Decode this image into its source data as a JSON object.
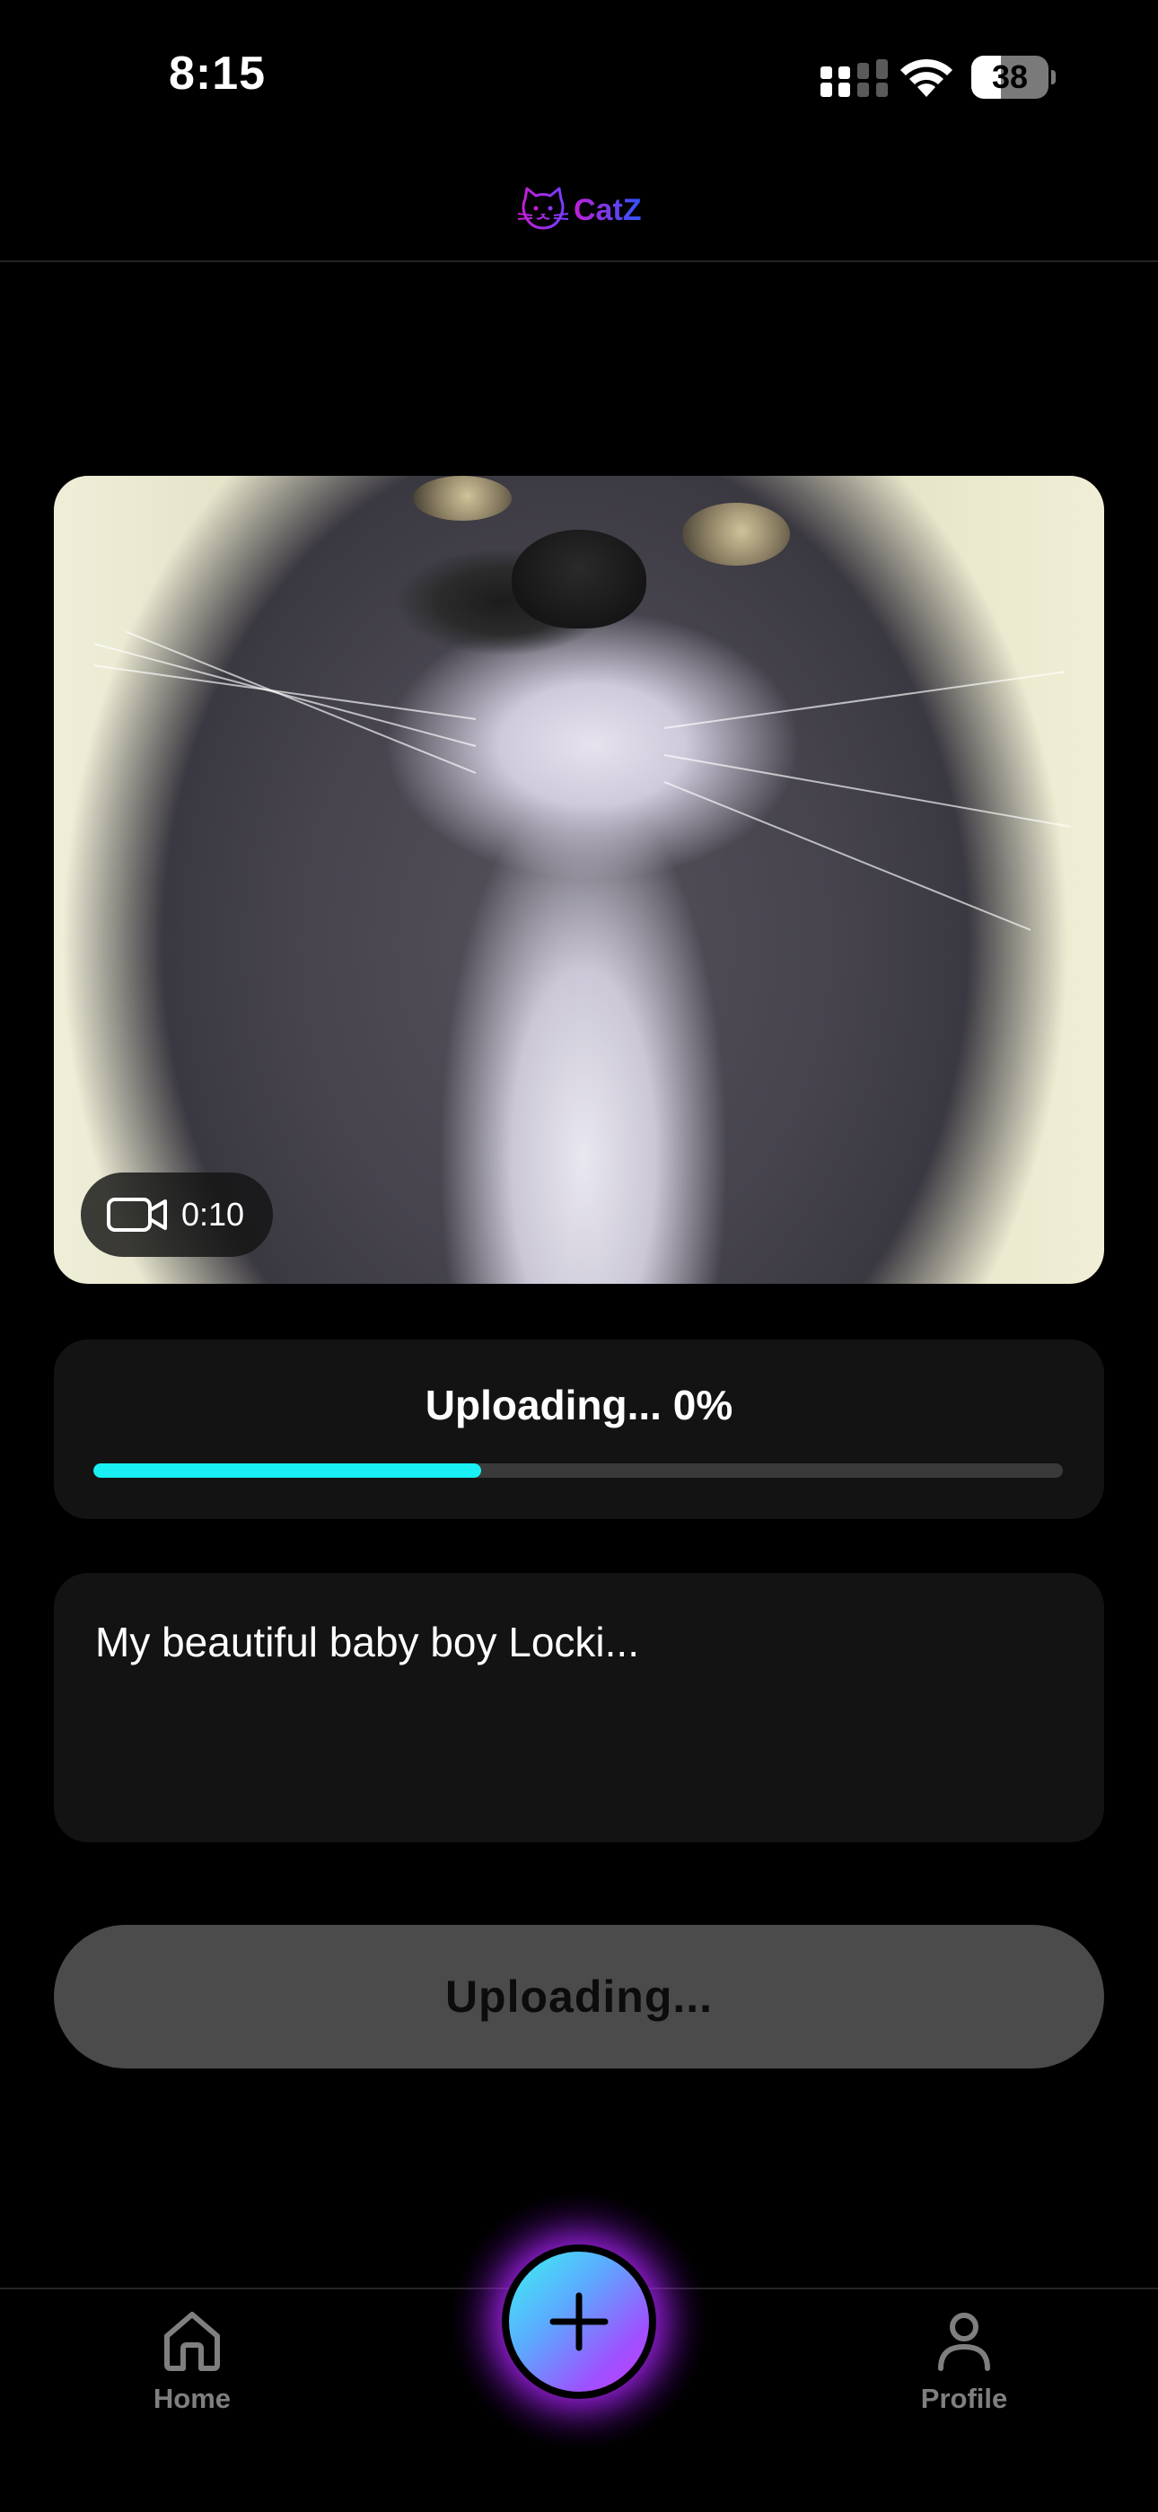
{
  "status_bar": {
    "time": "8:15",
    "battery_level": "38",
    "battery_percent": 38,
    "icons": [
      "signal-icon",
      "wifi-icon",
      "battery-icon"
    ]
  },
  "header": {
    "logo_text": "CatZ",
    "logo_icon": "cat-face-icon"
  },
  "media": {
    "type": "video",
    "duration": "0:10",
    "icon": "video-camera-icon"
  },
  "upload": {
    "status_label": "Uploading... 0%",
    "progress_bar_fraction": 0.4,
    "button_label": "Uploading..."
  },
  "caption": {
    "text": "My beautiful baby boy Locki..."
  },
  "tab_bar": {
    "tabs": [
      {
        "label": "Home",
        "icon": "home-icon"
      },
      {
        "label": "Profile",
        "icon": "profile-icon"
      }
    ],
    "fab_icon": "plus-icon"
  },
  "colors": {
    "background": "#000000",
    "card": "#131313",
    "progress_accent": "#19f0f4",
    "button_disabled": "#4b4b4b",
    "tab_inactive": "#7f7f7f",
    "fab_gradient_start": "#3cf3f2",
    "fab_gradient_end": "#c73bff",
    "logo_gradient_start": "#c21fd6",
    "logo_gradient_end": "#2d56ff"
  }
}
